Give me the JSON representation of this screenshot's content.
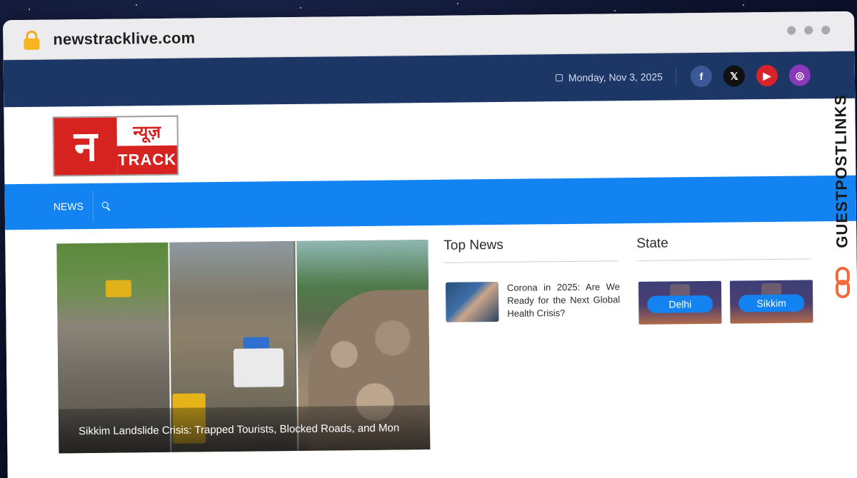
{
  "browser": {
    "url": "newstracklive.com"
  },
  "topbar": {
    "date": "Monday, Nov 3, 2025",
    "socials": [
      {
        "name": "facebook-icon",
        "glyph": "f",
        "color": "#3b5998"
      },
      {
        "name": "x-icon",
        "glyph": "𝕏",
        "color": "#111111"
      },
      {
        "name": "youtube-icon",
        "glyph": "▶",
        "color": "#d8232a"
      },
      {
        "name": "instagram-icon",
        "glyph": "◎",
        "color": "#8a3ab9"
      }
    ]
  },
  "logo": {
    "mark": "न",
    "hindi": "न्यूज़",
    "english": "TRACK"
  },
  "nav": {
    "items": [
      "NEWS"
    ]
  },
  "hero": {
    "caption": "Sikkim Landslide Crisis: Trapped Tourists, Blocked Roads, and Mon"
  },
  "top_news": {
    "title": "Top News",
    "items": [
      {
        "text": "Corona in 2025: Are We Ready for the Next Global Health Crisis?"
      }
    ]
  },
  "state": {
    "title": "State",
    "cards": [
      {
        "label": "Delhi"
      },
      {
        "label": "Sikkim"
      }
    ]
  },
  "watermark": {
    "text": "GUESTPOSTLINKS"
  },
  "colors": {
    "topbar": "#1c3766",
    "navbar": "#1283f0",
    "brand_red": "#d7231f",
    "pill": "#1283f0",
    "watermark_logo": "#f06a3a"
  }
}
